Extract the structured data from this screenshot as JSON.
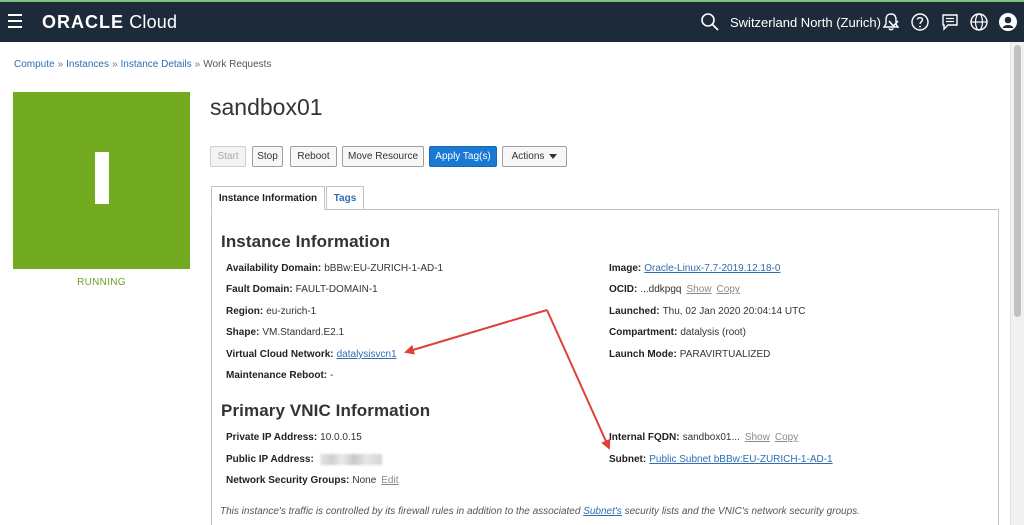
{
  "header": {
    "brand_main": "ORACLE",
    "brand_sub": "Cloud",
    "region": "Switzerland North (Zurich)",
    "icons": [
      "menu-icon",
      "search-icon",
      "bell-icon",
      "help-icon",
      "chat-icon",
      "globe-icon",
      "user-icon"
    ]
  },
  "breadcrumb": {
    "items": [
      "Compute",
      "Instances",
      "Instance Details"
    ],
    "current": "Work Requests",
    "separator": "»"
  },
  "status": {
    "label": "RUNNING",
    "tile_color": "#72ab1f"
  },
  "instance": {
    "name": "sandbox01"
  },
  "actions": {
    "start": "Start",
    "stop": "Stop",
    "reboot": "Reboot",
    "move": "Move Resource",
    "apply_tags": "Apply Tag(s)",
    "actions_menu": "Actions"
  },
  "tabs": {
    "info": "Instance Information",
    "tags": "Tags"
  },
  "instance_info": {
    "title": "Instance Information",
    "availability_domain": {
      "label": "Availability Domain:",
      "value": "bBBw:EU-ZURICH-1-AD-1"
    },
    "fault_domain": {
      "label": "Fault Domain:",
      "value": "FAULT-DOMAIN-1"
    },
    "region": {
      "label": "Region:",
      "value": "eu-zurich-1"
    },
    "shape": {
      "label": "Shape:",
      "value": "VM.Standard.E2.1"
    },
    "vcn": {
      "label": "Virtual Cloud Network:",
      "value": "datalysisvcn1"
    },
    "maintenance_reboot": {
      "label": "Maintenance Reboot:",
      "value": "-"
    },
    "image": {
      "label": "Image:",
      "value": "Oracle-Linux-7.7-2019.12.18-0"
    },
    "ocid": {
      "label": "OCID:",
      "value": "...ddkpgq",
      "show": "Show",
      "copy": "Copy"
    },
    "launched": {
      "label": "Launched:",
      "value": "Thu, 02 Jan 2020 20:04:14 UTC"
    },
    "compartment": {
      "label": "Compartment:",
      "value": "datalysis (root)"
    },
    "launch_mode": {
      "label": "Launch Mode:",
      "value": "PARAVIRTUALIZED"
    }
  },
  "vnic_info": {
    "title": "Primary VNIC Information",
    "private_ip": {
      "label": "Private IP Address:",
      "value": "10.0.0.15"
    },
    "public_ip": {
      "label": "Public IP Address:"
    },
    "nsg": {
      "label": "Network Security Groups:",
      "value": "None",
      "edit": "Edit"
    },
    "internal_fqdn": {
      "label": "Internal FQDN:",
      "value": "sandbox01...",
      "show": "Show",
      "copy": "Copy"
    },
    "subnet": {
      "label": "Subnet:",
      "value": "Public Subnet bBBw:EU-ZURICH-1-AD-1"
    }
  },
  "footnote": {
    "before": "This instance's traffic is controlled by its firewall rules in addition to the associated ",
    "link": "Subnet's",
    "after": " security lists and the VNIC's network security groups."
  },
  "colors": {
    "topbar": "#1d2a3a",
    "link": "#2d6db4",
    "primary_button": "#1a7ad3",
    "annotation_arrow": "#e0403a"
  }
}
